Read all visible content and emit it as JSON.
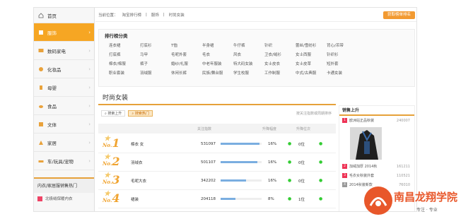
{
  "sidebar": {
    "items": [
      {
        "label": "首页",
        "icon": "home-icon"
      },
      {
        "label": "服饰",
        "icon": "shirt-icon"
      },
      {
        "label": "数码家电",
        "icon": "device-icon"
      },
      {
        "label": "化妆品",
        "icon": "cosmetics-icon"
      },
      {
        "label": "母婴",
        "icon": "baby-icon"
      },
      {
        "label": "食品",
        "icon": "food-icon"
      },
      {
        "label": "文体",
        "icon": "sports-icon"
      },
      {
        "label": "家居",
        "icon": "home-goods-icon"
      },
      {
        "label": "车/玩具/宠物",
        "icon": "car-icon"
      }
    ],
    "section_title": "内衣/家居服销售热门",
    "sub_item": "北极绒保暖内衣"
  },
  "breadcrumb": {
    "prefix": "当前位置：",
    "parts": [
      "淘宝排行榜",
      "服饰",
      "时尚女装"
    ]
  },
  "top_button": "获取榜单排名",
  "categories": {
    "title": "排行榜分类",
    "items": [
      "连衣裙",
      "打底衫",
      "T恤",
      "半身裙",
      "牛仔裤",
      "针织",
      "蕾丝/雪纺衫",
      "背心/吊带",
      "打底裤",
      "马甲",
      "毛呢外套",
      "毛衣",
      "风衣",
      "卫衣/绒衫",
      "女士西服",
      "针织衫",
      "棉衣/棉服",
      "裤子",
      "婚纱/礼服",
      "中老年服装",
      "特大码女装",
      "女士皮衣",
      "女士皮草",
      "短外套",
      "职业套装",
      "羽绒服",
      "休闲长裤",
      "民族/舞台服",
      "学生校服",
      "工作制服",
      "中式/古典服",
      "卡通女装"
    ]
  },
  "section_title": "时尚女装",
  "filters": {
    "chips": [
      "搜索上升",
      "搜索热门"
    ],
    "note": "按关注指数或周期排序"
  },
  "table": {
    "headers": [
      "关注指数",
      "升降幅度",
      "升降位次"
    ],
    "rows": [
      {
        "rank": "1",
        "name": "棉衣 女",
        "score": "531097",
        "fill": 0.95,
        "pct": "16%",
        "change": "0位"
      },
      {
        "rank": "2",
        "name": "羽绒衣",
        "score": "501107",
        "fill": 0.9,
        "pct": "16%",
        "change": "0位"
      },
      {
        "rank": "3",
        "name": "毛呢大衣",
        "score": "342202",
        "fill": 0.62,
        "pct": "16%",
        "change": "0位"
      },
      {
        "rank": "4",
        "name": "裙装",
        "score": "204118",
        "fill": 0.37,
        "pct": "8%",
        "change": "1位"
      }
    ]
  },
  "right_panel": {
    "title": "销售上升",
    "items": [
      {
        "n": "1",
        "name": "欧洲站正品秋装",
        "value": "240007"
      },
      {
        "n": "2",
        "name": "加绒加厚 2014秋",
        "value": "161211"
      },
      {
        "n": "3",
        "name": "毛衣女秋装外套",
        "value": "110521"
      },
      {
        "n": "4",
        "name": "2014秋装新款",
        "value": "76010"
      }
    ]
  },
  "watermark": {
    "text": "南昌龙翔学院",
    "sub": "专注 · 专业"
  }
}
